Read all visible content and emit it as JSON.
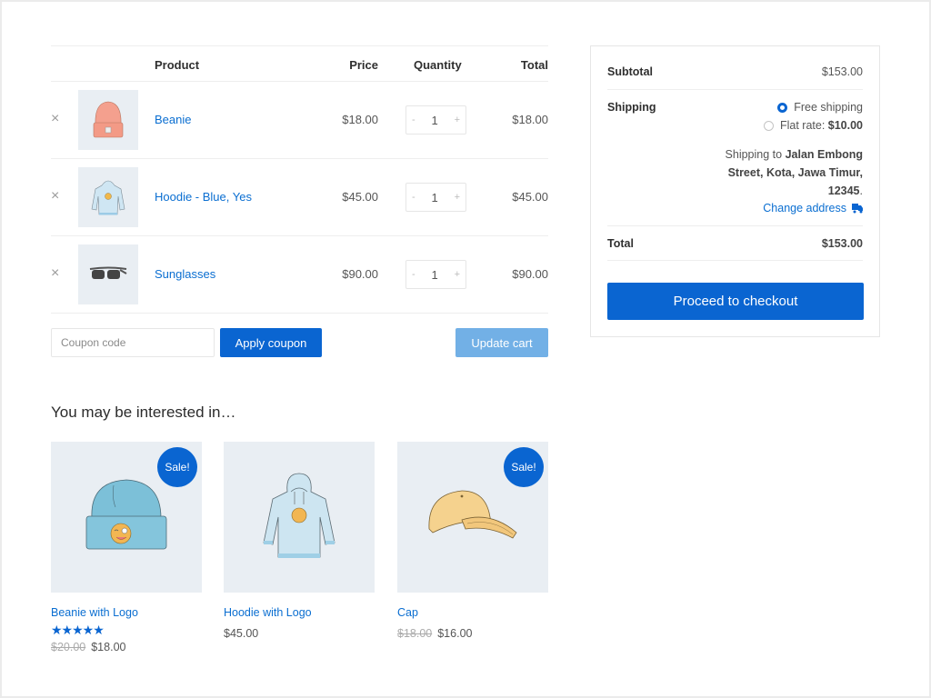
{
  "cart": {
    "headers": {
      "product": "Product",
      "price": "Price",
      "quantity": "Quantity",
      "total": "Total"
    },
    "remove_icon": "×",
    "items": [
      {
        "name": "Beanie",
        "price": "$18.00",
        "quantity": "1",
        "total": "$18.00",
        "image": "beanie-orange-icon"
      },
      {
        "name": "Hoodie - Blue, Yes",
        "price": "$45.00",
        "quantity": "1",
        "total": "$45.00",
        "image": "hoodie-blue-icon"
      },
      {
        "name": "Sunglasses",
        "price": "$90.00",
        "quantity": "1",
        "total": "$90.00",
        "image": "sunglasses-icon"
      }
    ],
    "stepper": {
      "minus": "-",
      "plus": "+"
    },
    "coupon": {
      "placeholder": "Coupon code",
      "value": ""
    },
    "apply_coupon_label": "Apply coupon",
    "update_cart_label": "Update cart"
  },
  "cross_sells": {
    "title": "You may be interested in…",
    "items": [
      {
        "name": "Beanie with Logo",
        "sale_badge": "Sale!",
        "rating_stars": "★★★★★",
        "rating": 5,
        "regular_price": "$20.00",
        "price": "$18.00"
      },
      {
        "name": "Hoodie with Logo",
        "price": "$45.00"
      },
      {
        "name": "Cap",
        "sale_badge": "Sale!",
        "regular_price": "$18.00",
        "price": "$16.00"
      }
    ]
  },
  "totals": {
    "subtotal_label": "Subtotal",
    "subtotal_value": "$153.00",
    "shipping_label": "Shipping",
    "shipping_options": [
      {
        "label": "Free shipping",
        "selected": true
      },
      {
        "label": "Flat rate: ",
        "amount": "$10.00",
        "selected": false
      }
    ],
    "shipping_to_prefix": "Shipping to ",
    "shipping_address": "Jalan Embong Street, Kota, Jawa Timur, 12345",
    "shipping_address_suffix": ".",
    "change_address_label": "Change address",
    "total_label": "Total",
    "total_value": "$153.00",
    "checkout_label": "Proceed to checkout"
  },
  "colors": {
    "accent": "#0a65d1",
    "link": "#0a6ed1",
    "update_disabled": "#72b0e6",
    "thumb_bg": "#e9eef3"
  }
}
